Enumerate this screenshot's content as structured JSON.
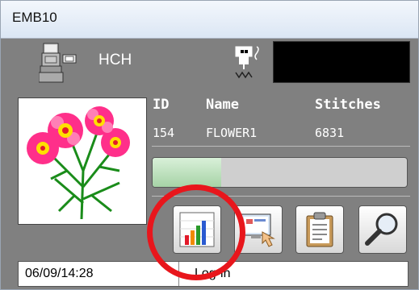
{
  "window": {
    "title": "EMB10"
  },
  "machine": {
    "head_label": "HCH",
    "machine_icon": "embroidery-machine-icon",
    "needle_icon": "needle-thread-icon"
  },
  "design": {
    "headers": {
      "id": "ID",
      "name": "Name",
      "stitches": "Stitches"
    },
    "row": {
      "id": "154",
      "name": "FLOWER1",
      "stitches": "6831"
    },
    "thumbnail_icon": "flower-embroidery-thumbnail"
  },
  "progress": {
    "fraction": 0.27
  },
  "toolbar": {
    "buttons": [
      {
        "icon": "bar-chart-icon"
      },
      {
        "icon": "monitor-hand-icon"
      },
      {
        "icon": "clipboard-icon"
      },
      {
        "icon": "magnifier-icon"
      }
    ]
  },
  "status": {
    "time": "06/09/14:28",
    "message": "Log-in"
  },
  "colors": {
    "highlight": "#e8161c",
    "panel": "#808080"
  }
}
